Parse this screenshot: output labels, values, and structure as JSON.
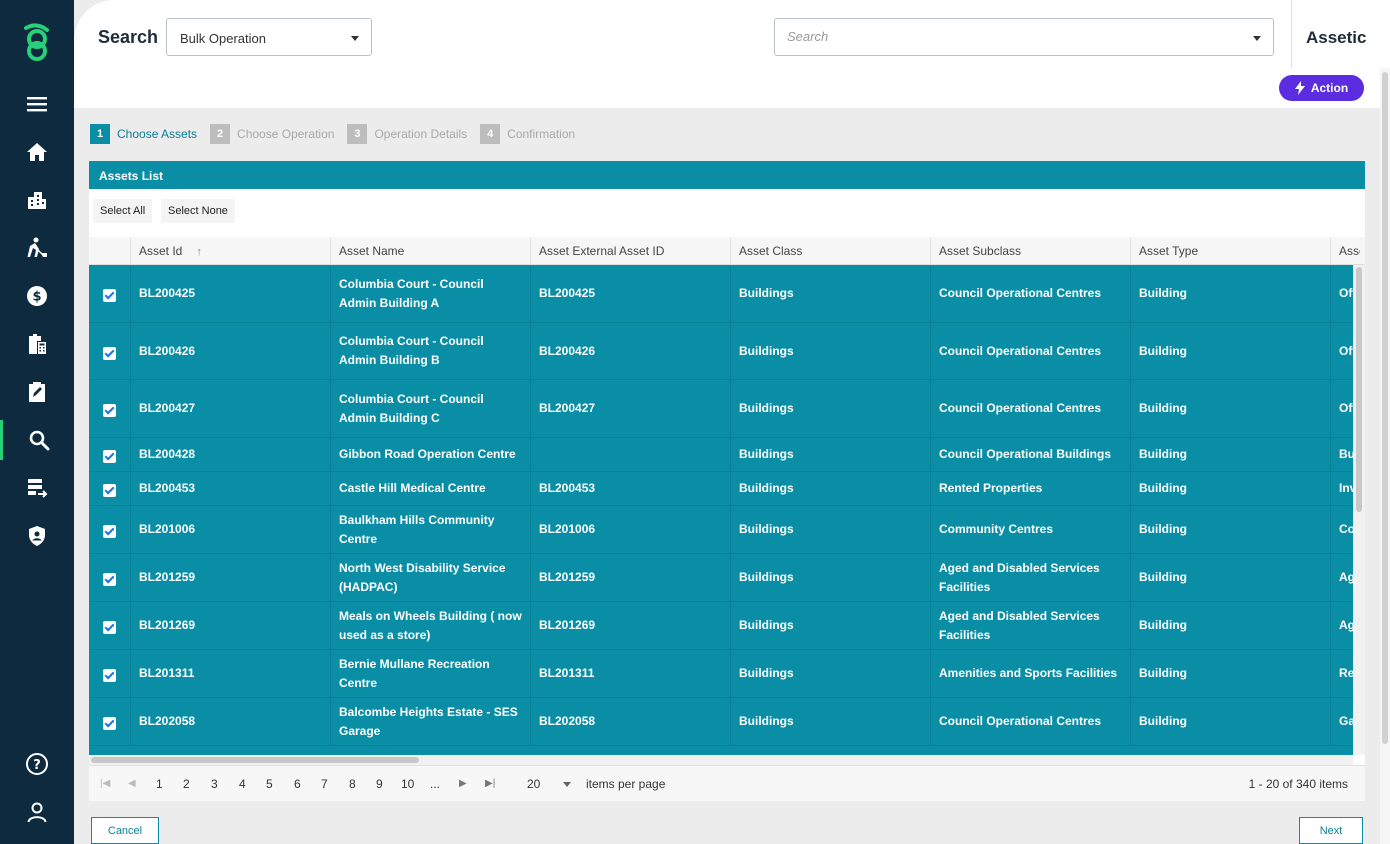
{
  "header": {
    "title": "Search",
    "operation_select": "Bulk Operation",
    "search_placeholder": "Search",
    "brand": "Assetic"
  },
  "action_button": "Action",
  "steps": [
    {
      "num": "1",
      "label": "Choose Assets",
      "active": true
    },
    {
      "num": "2",
      "label": "Choose Operation",
      "active": false
    },
    {
      "num": "3",
      "label": "Operation Details",
      "active": false
    },
    {
      "num": "4",
      "label": "Confirmation",
      "active": false
    }
  ],
  "panel": {
    "title": "Assets List",
    "select_all": "Select All",
    "select_none": "Select None"
  },
  "columns": [
    "Asset Id",
    "Asset Name",
    "Asset External Asset ID",
    "Asset Class",
    "Asset Subclass",
    "Asset Type",
    "Asset Subtype"
  ],
  "rows": [
    {
      "id": "BL200425",
      "name": "Columbia Court - Council Admin Building A",
      "ext": "BL200425",
      "cls": "Buildings",
      "sub": "Council Operational Centres",
      "type": "Building",
      "subtype": "Office"
    },
    {
      "id": "BL200426",
      "name": "Columbia Court - Council Admin Building B",
      "ext": "BL200426",
      "cls": "Buildings",
      "sub": "Council Operational Centres",
      "type": "Building",
      "subtype": "Office"
    },
    {
      "id": "BL200427",
      "name": "Columbia Court - Council Admin Building C",
      "ext": "BL200427",
      "cls": "Buildings",
      "sub": "Council Operational Centres",
      "type": "Building",
      "subtype": "Office"
    },
    {
      "id": "BL200428",
      "name": "Gibbon Road Operation Centre",
      "ext": "",
      "cls": "Buildings",
      "sub": "Council Operational Buildings",
      "type": "Building",
      "subtype": "Bui"
    },
    {
      "id": "BL200453",
      "name": "Castle Hill Medical Centre",
      "ext": "BL200453",
      "cls": "Buildings",
      "sub": "Rented Properties",
      "type": "Building",
      "subtype": "Inv"
    },
    {
      "id": "BL201006",
      "name": "Baulkham Hills Community Centre",
      "ext": "BL201006",
      "cls": "Buildings",
      "sub": "Community Centres",
      "type": "Building",
      "subtype": "Co"
    },
    {
      "id": "BL201259",
      "name": "North West Disability Service (HADPAC)",
      "ext": "BL201259",
      "cls": "Buildings",
      "sub": "Aged and Disabled Services Facilities",
      "type": "Building",
      "subtype": "Ag"
    },
    {
      "id": "BL201269",
      "name": "Meals on Wheels Building ( now used as a store)",
      "ext": "BL201269",
      "cls": "Buildings",
      "sub": "Aged and Disabled Services Facilities",
      "type": "Building",
      "subtype": "Ag"
    },
    {
      "id": "BL201311",
      "name": "Bernie Mullane Recreation Centre",
      "ext": "BL201311",
      "cls": "Buildings",
      "sub": "Amenities and Sports Facilities",
      "type": "Building",
      "subtype": "Rec"
    },
    {
      "id": "BL202058",
      "name": "Balcombe Heights Estate - SES Garage",
      "ext": "BL202058",
      "cls": "Buildings",
      "sub": "Council Operational Centres",
      "type": "Building",
      "subtype": "Ga"
    }
  ],
  "pager": {
    "pages": [
      "1",
      "2",
      "3",
      "4",
      "5",
      "6",
      "7",
      "8",
      "9",
      "10",
      "..."
    ],
    "page_size": "20",
    "items_per_page": "items per page",
    "summary": "1 - 20 of 340 items"
  },
  "footer": {
    "cancel": "Cancel",
    "next": "Next"
  },
  "colors": {
    "sidebar": "#0d2a3f",
    "accent_green": "#28d07a",
    "teal": "#0a8ea6",
    "action_purple": "#5b2ce0"
  }
}
